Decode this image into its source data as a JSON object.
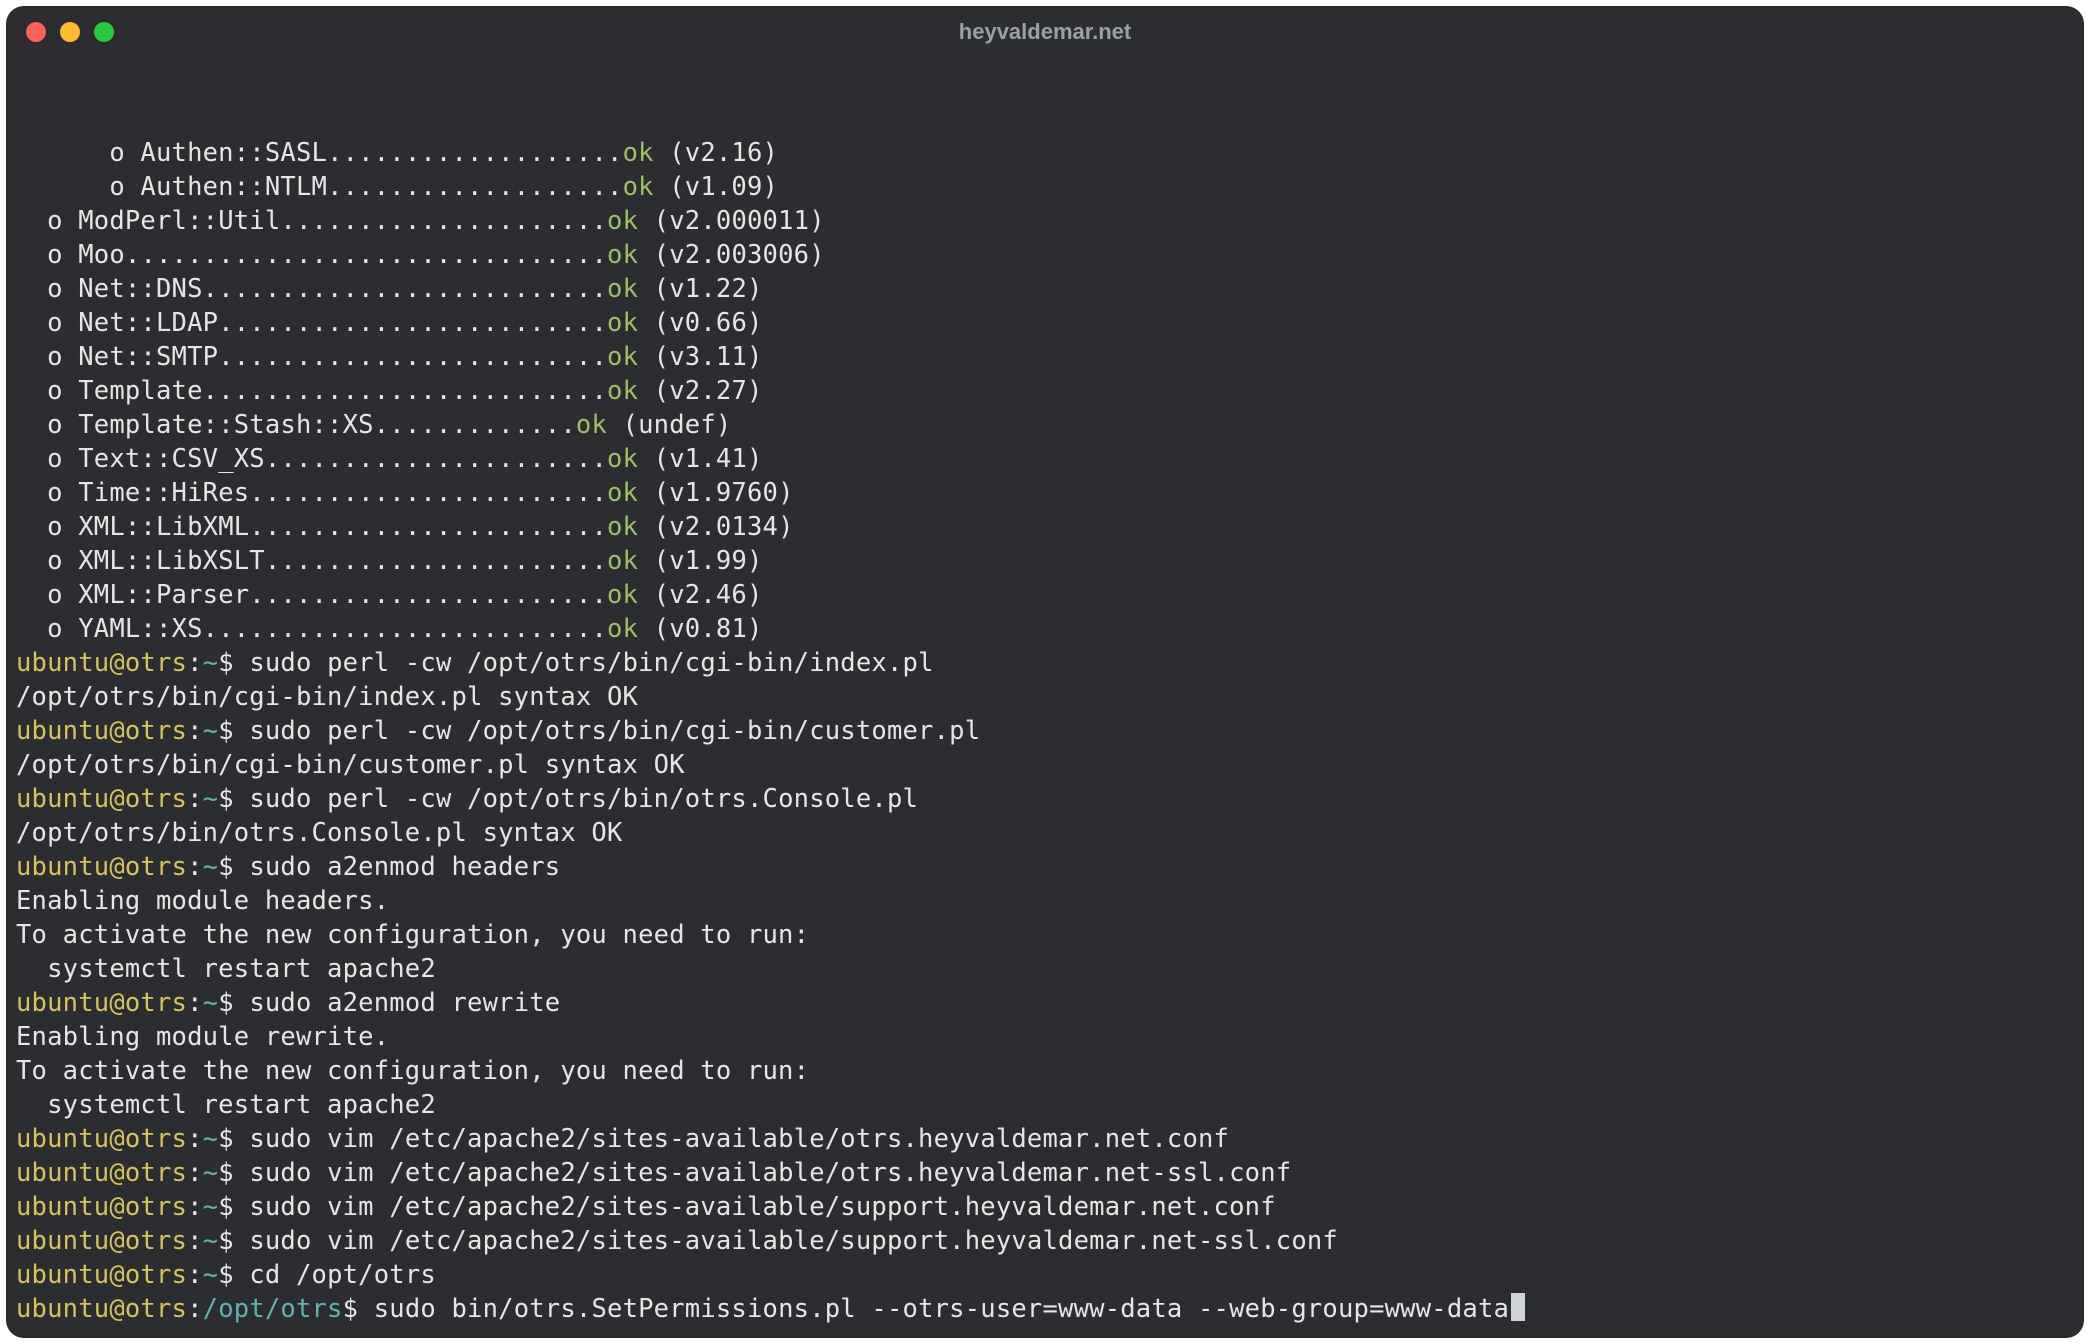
{
  "window": {
    "title": "heyvaldemar.net"
  },
  "prompt": {
    "user_host": "ubuntu@otrs",
    "home_path": "~",
    "cwd_path": "/opt/otrs",
    "sigil": "$"
  },
  "modules": [
    {
      "indent": "    ",
      "bullet": "  o ",
      "name": "Authen::SASL",
      "dots": "...................",
      "status": "ok",
      "version": "(v2.16)"
    },
    {
      "indent": "    ",
      "bullet": "  o ",
      "name": "Authen::NTLM",
      "dots": "...................",
      "status": "ok",
      "version": "(v1.09)"
    },
    {
      "indent": "  ",
      "bullet": "o ",
      "name": "ModPerl::Util",
      "dots": ".....................",
      "status": "ok",
      "version": "(v2.000011)"
    },
    {
      "indent": "  ",
      "bullet": "o ",
      "name": "Moo",
      "dots": "...............................",
      "status": "ok",
      "version": "(v2.003006)"
    },
    {
      "indent": "  ",
      "bullet": "o ",
      "name": "Net::DNS",
      "dots": "..........................",
      "status": "ok",
      "version": "(v1.22)"
    },
    {
      "indent": "  ",
      "bullet": "o ",
      "name": "Net::LDAP",
      "dots": ".........................",
      "status": "ok",
      "version": "(v0.66)"
    },
    {
      "indent": "  ",
      "bullet": "o ",
      "name": "Net::SMTP",
      "dots": ".........................",
      "status": "ok",
      "version": "(v3.11)"
    },
    {
      "indent": "  ",
      "bullet": "o ",
      "name": "Template",
      "dots": "..........................",
      "status": "ok",
      "version": "(v2.27)"
    },
    {
      "indent": "  ",
      "bullet": "o ",
      "name": "Template::Stash::XS",
      "dots": ".............",
      "status": "ok",
      "version": "(undef)"
    },
    {
      "indent": "  ",
      "bullet": "o ",
      "name": "Text::CSV_XS",
      "dots": "......................",
      "status": "ok",
      "version": "(v1.41)"
    },
    {
      "indent": "  ",
      "bullet": "o ",
      "name": "Time::HiRes",
      "dots": ".......................",
      "status": "ok",
      "version": "(v1.9760)"
    },
    {
      "indent": "  ",
      "bullet": "o ",
      "name": "XML::LibXML",
      "dots": ".......................",
      "status": "ok",
      "version": "(v2.0134)"
    },
    {
      "indent": "  ",
      "bullet": "o ",
      "name": "XML::LibXSLT",
      "dots": "......................",
      "status": "ok",
      "version": "(v1.99)"
    },
    {
      "indent": "  ",
      "bullet": "o ",
      "name": "XML::Parser",
      "dots": ".......................",
      "status": "ok",
      "version": "(v2.46)"
    },
    {
      "indent": "  ",
      "bullet": "o ",
      "name": "YAML::XS",
      "dots": "..........................",
      "status": "ok",
      "version": "(v0.81)"
    }
  ],
  "history": [
    {
      "type": "cmd",
      "path": "home",
      "text": "sudo perl -cw /opt/otrs/bin/cgi-bin/index.pl"
    },
    {
      "type": "out",
      "text": "/opt/otrs/bin/cgi-bin/index.pl syntax OK"
    },
    {
      "type": "cmd",
      "path": "home",
      "text": "sudo perl -cw /opt/otrs/bin/cgi-bin/customer.pl"
    },
    {
      "type": "out",
      "text": "/opt/otrs/bin/cgi-bin/customer.pl syntax OK"
    },
    {
      "type": "cmd",
      "path": "home",
      "text": "sudo perl -cw /opt/otrs/bin/otrs.Console.pl"
    },
    {
      "type": "out",
      "text": "/opt/otrs/bin/otrs.Console.pl syntax OK"
    },
    {
      "type": "cmd",
      "path": "home",
      "text": "sudo a2enmod headers"
    },
    {
      "type": "out",
      "text": "Enabling module headers."
    },
    {
      "type": "out",
      "text": "To activate the new configuration, you need to run:"
    },
    {
      "type": "out",
      "text": "  systemctl restart apache2"
    },
    {
      "type": "cmd",
      "path": "home",
      "text": "sudo a2enmod rewrite"
    },
    {
      "type": "out",
      "text": "Enabling module rewrite."
    },
    {
      "type": "out",
      "text": "To activate the new configuration, you need to run:"
    },
    {
      "type": "out",
      "text": "  systemctl restart apache2"
    },
    {
      "type": "cmd",
      "path": "home",
      "text": "sudo vim /etc/apache2/sites-available/otrs.heyvaldemar.net.conf"
    },
    {
      "type": "cmd",
      "path": "home",
      "text": "sudo vim /etc/apache2/sites-available/otrs.heyvaldemar.net-ssl.conf"
    },
    {
      "type": "cmd",
      "path": "home",
      "text": "sudo vim /etc/apache2/sites-available/support.heyvaldemar.net.conf"
    },
    {
      "type": "cmd",
      "path": "home",
      "text": "sudo vim /etc/apache2/sites-available/support.heyvaldemar.net-ssl.conf"
    },
    {
      "type": "cmd",
      "path": "home",
      "text": "cd /opt/otrs"
    },
    {
      "type": "cmd",
      "path": "cwd",
      "text": "sudo bin/otrs.SetPermissions.pl --otrs-user=www-data --web-group=www-data",
      "cursor": true
    }
  ]
}
